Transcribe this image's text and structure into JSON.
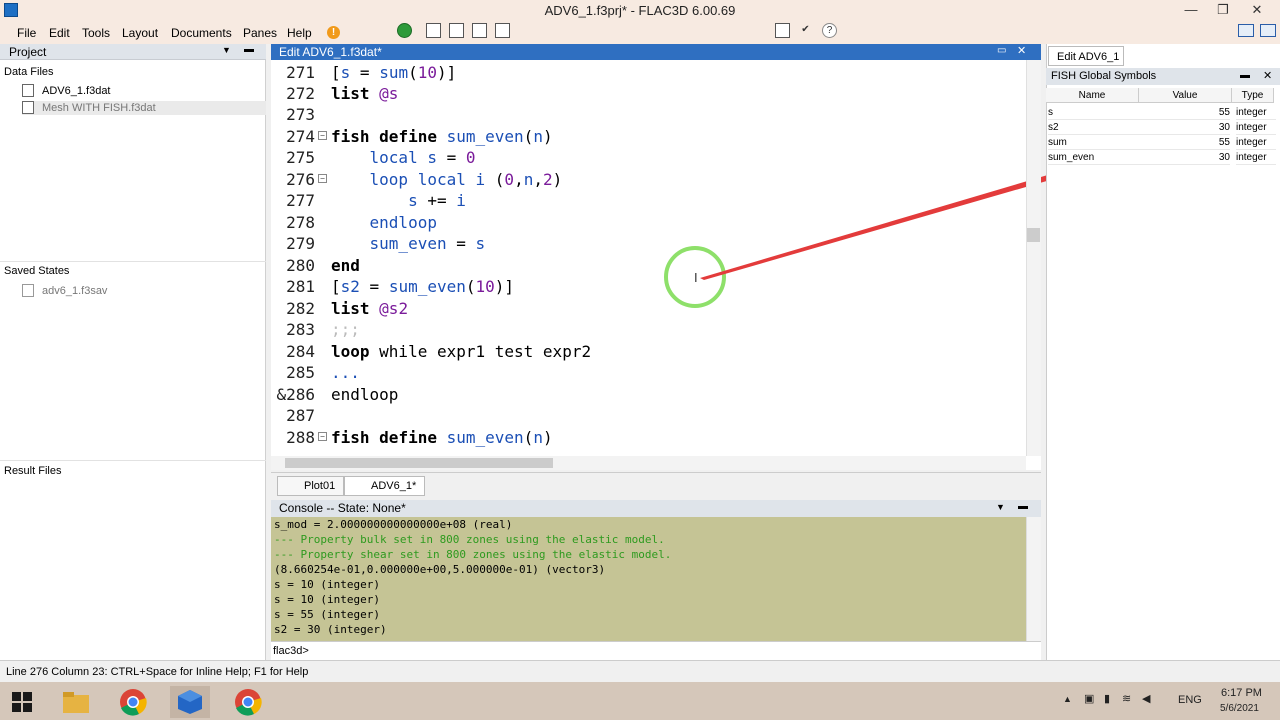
{
  "window": {
    "title": "ADV6_1.f3prj* - FLAC3D 6.00.69",
    "minimize": "—",
    "restore": "❐",
    "close": "✕"
  },
  "menu": [
    "File",
    "Edit",
    "Tools",
    "Layout",
    "Documents",
    "Panes",
    "Help"
  ],
  "help_badge": "!",
  "project_panel": {
    "title": "Project",
    "data_files_label": "Data Files",
    "data_files": [
      "ADV6_1.f3dat",
      "Mesh WITH FISH.f3dat"
    ],
    "saved_states_label": "Saved States",
    "saved_states": [
      "adv6_1.f3sav"
    ],
    "result_files_label": "Result Files"
  },
  "editor": {
    "title": "Edit ADV6_1.f3dat*",
    "lines": [
      {
        "n": "271",
        "html": "[s = sum(10)]"
      },
      {
        "n": "272",
        "html": "list @s"
      },
      {
        "n": "273",
        "html": ""
      },
      {
        "n": "274",
        "html": "fish define sum_even(n)"
      },
      {
        "n": "275",
        "html": "    local s = 0"
      },
      {
        "n": "276",
        "html": "    loop local i (0,n,2)"
      },
      {
        "n": "277",
        "html": "        s += i"
      },
      {
        "n": "278",
        "html": "    endloop"
      },
      {
        "n": "279",
        "html": "    sum_even = s"
      },
      {
        "n": "280",
        "html": "end"
      },
      {
        "n": "281",
        "html": "[s2 = sum_even(10)]"
      },
      {
        "n": "282",
        "html": "list @s2"
      },
      {
        "n": "283",
        "html": ";;;"
      },
      {
        "n": "284",
        "html": "loop while expr1 test expr2"
      },
      {
        "n": "285",
        "html": "..."
      },
      {
        "n": "&286",
        "html": "endloop"
      },
      {
        "n": "287",
        "html": ""
      },
      {
        "n": "288",
        "html": "fish define sum_even(n)"
      }
    ]
  },
  "tabs": [
    "Plot01",
    "ADV6_1*"
  ],
  "console": {
    "title": "Console -- State: None*",
    "lines": [
      {
        "text": "s_mod = 2.000000000000000e+08 (real)",
        "green": false
      },
      {
        "text": "--- Property bulk set in 800 zones using the elastic model.",
        "green": true
      },
      {
        "text": "--- Property shear set in 800 zones using the elastic model.",
        "green": true
      },
      {
        "text": "(8.660254e-01,0.000000e+00,5.000000e-01) (vector3)",
        "green": false
      },
      {
        "text": "s = 10 (integer)",
        "green": false
      },
      {
        "text": "s = 10 (integer)",
        "green": false
      },
      {
        "text": "s = 55 (integer)",
        "green": false
      },
      {
        "text": "s2 = 30 (integer)",
        "green": false
      }
    ],
    "prompt": "flac3d>"
  },
  "right_panel": {
    "tab": "Edit ADV6_1",
    "title": "FISH Global Symbols",
    "headers": [
      "Name",
      "Value",
      "Type"
    ],
    "rows": [
      {
        "name": "s",
        "value": "55",
        "type": "integer"
      },
      {
        "name": "s2",
        "value": "30",
        "type": "integer"
      },
      {
        "name": "sum",
        "value": "55",
        "type": "integer"
      },
      {
        "name": "sum_even",
        "value": "30",
        "type": "integer"
      }
    ]
  },
  "status": "Line 276 Column 23: CTRL+Space for Inline Help; F1 for Help",
  "taskbar": {
    "lang": "ENG",
    "time": "6:17 PM",
    "date": "5/6/2021"
  },
  "colors": {
    "accent": "#2f6fc1",
    "console_bg": "#c5c495",
    "titlebar": "#f7eae1"
  }
}
